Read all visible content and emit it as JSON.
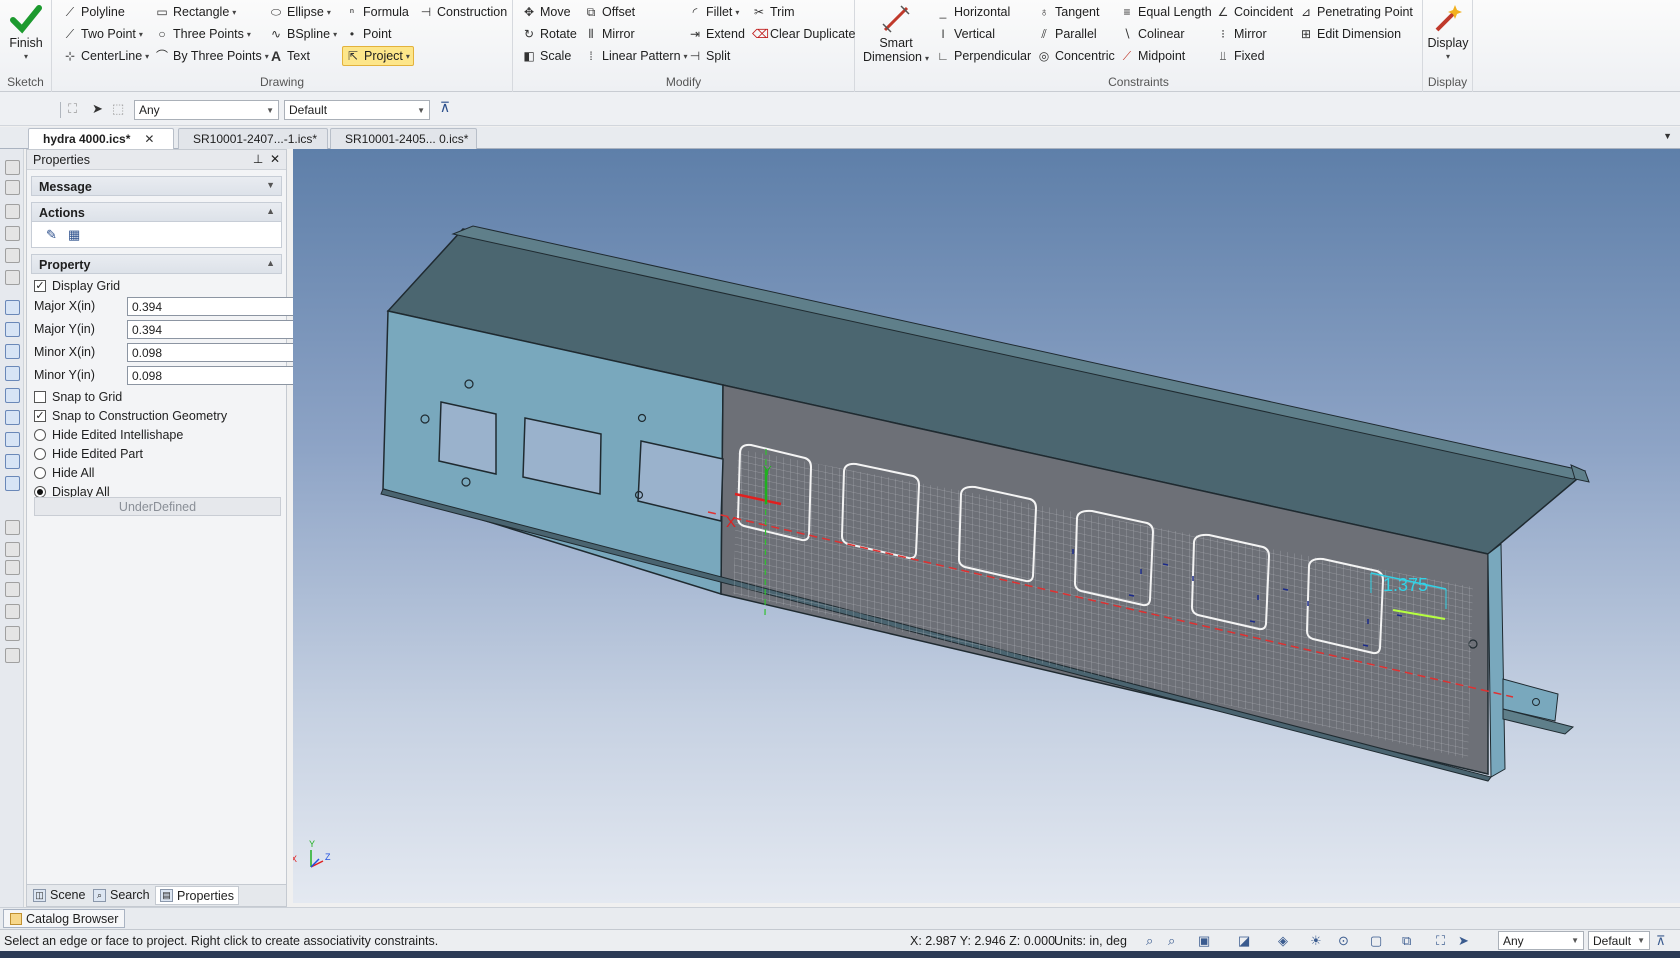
{
  "ribbon": {
    "sketch": {
      "finish_label": "Finish",
      "group_label": "Sketch"
    },
    "drawing": {
      "group_label": "Drawing",
      "polyline": "Polyline",
      "rectangle": "Rectangle",
      "ellipse": "Ellipse",
      "formula": "Formula",
      "construction": "Construction",
      "two_point": "Two Point",
      "three_points": "Three Points",
      "bspline": "BSpline",
      "point": "Point",
      "centerline": "CenterLine",
      "by_three_points": "By Three Points",
      "text": "Text",
      "project": "Project"
    },
    "modify": {
      "group_label": "Modify",
      "move": "Move",
      "offset": "Offset",
      "fillet": "Fillet",
      "trim": "Trim",
      "rotate": "Rotate",
      "mirror": "Mirror",
      "extend": "Extend",
      "clear_duplicate": "Clear Duplicate",
      "scale": "Scale",
      "linear_pattern": "Linear Pattern",
      "split": "Split"
    },
    "constraints": {
      "group_label": "Constraints",
      "smart_dimension_1": "Smart",
      "smart_dimension_2": "Dimension",
      "horizontal": "Horizontal",
      "tangent": "Tangent",
      "equal_length": "Equal Length",
      "coincident": "Coincident",
      "penetrating_point": "Penetrating Point",
      "vertical": "Vertical",
      "parallel": "Parallel",
      "colinear": "Colinear",
      "mirror": "Mirror",
      "edit_dimension": "Edit Dimension",
      "perpendicular": "Perpendicular",
      "concentric": "Concentric",
      "midpoint": "Midpoint",
      "fixed": "Fixed"
    },
    "display": {
      "display_label": "Display",
      "group_label": "Display"
    }
  },
  "toolbar": {
    "filter_value": "Any",
    "style_value": "Default"
  },
  "tabs": [
    {
      "label": "hydra 4000.ics*"
    },
    {
      "label": "SR10001-2407...-1.ics*"
    },
    {
      "label": "SR10001-2405... 0.ics*"
    }
  ],
  "properties": {
    "title": "Properties",
    "message_label": "Message",
    "actions_label": "Actions",
    "property_label": "Property",
    "display_grid": "Display Grid",
    "major_x_label": "Major X(in)",
    "major_x_value": "0.394",
    "major_y_label": "Major Y(in)",
    "major_y_value": "0.394",
    "minor_x_label": "Minor X(in)",
    "minor_x_value": "0.098",
    "minor_y_label": "Minor Y(in)",
    "minor_y_value": "0.098",
    "snap_grid": "Snap to Grid",
    "snap_construction": "Snap to Construction Geometry",
    "hide_intellishape": "Hide Edited Intellishape",
    "hide_part": "Hide Edited Part",
    "hide_all": "Hide All",
    "display_all": "Display All",
    "underdefined": "UnderDefined",
    "panel_tabs": {
      "scene": "Scene",
      "search": "Search",
      "properties": "Properties"
    }
  },
  "viewport": {
    "dimension_value": "1.375",
    "axis_x": "X",
    "axis_y": "Y",
    "axis_z": "Z"
  },
  "catalog_label": "Catalog Browser",
  "status": {
    "message": "Select an edge or face to project.  Right click to create associativity constraints.",
    "coords": "X: 2.987 Y: 2.946 Z: 0.000",
    "units": "Units: in, deg",
    "filter_value": "Any",
    "style_value": "Default"
  },
  "colors": {
    "accent": "#fde68a",
    "sketch_red": "#e03030",
    "dimension_cyan": "#32d2e6",
    "part_gray": "#6d7077"
  }
}
